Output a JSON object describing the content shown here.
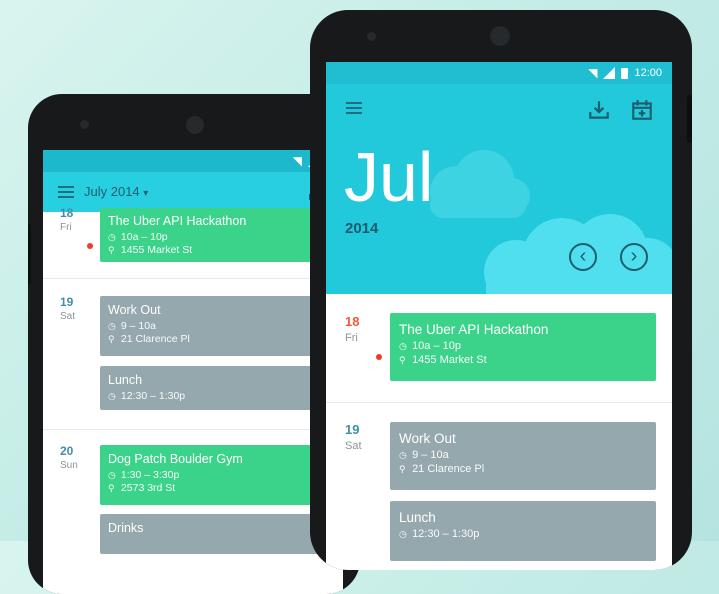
{
  "left_phone": {
    "header": {
      "month_label": "July 2014",
      "dropdown_caret": "▾"
    },
    "days": [
      {
        "num": "18",
        "wd": "Fri"
      },
      {
        "num": "19",
        "wd": "Sat"
      },
      {
        "num": "20",
        "wd": "Sun"
      }
    ],
    "events": [
      {
        "title": "The Uber API Hackathon",
        "time": "10a – 10p",
        "place": "1455 Market St",
        "color": "#3bd38a"
      },
      {
        "title": "Work Out",
        "time": "9 – 10a",
        "place": "21 Clarence Pl",
        "color": "#95a8ad"
      },
      {
        "title": "Lunch",
        "time": "12:30 – 1:30p",
        "color": "#95a8ad"
      },
      {
        "title": "Dog Patch Boulder Gym",
        "time": "1:30 – 3:30p",
        "place": "2573 3rd St",
        "color": "#3bd38a"
      },
      {
        "title": "Drinks",
        "color": "#95a8ad"
      }
    ]
  },
  "right_phone": {
    "status": {
      "time": "12:00"
    },
    "hero": {
      "month": "Jul",
      "year": "2014",
      "prev_glyph": "‹",
      "next_glyph": "›"
    },
    "days": [
      {
        "num": "18",
        "wd": "Fri"
      },
      {
        "num": "19",
        "wd": "Sat"
      }
    ],
    "events": [
      {
        "title": "The Uber API Hackathon",
        "time": "10a – 10p",
        "place": "1455 Market St",
        "color": "#3bd38a"
      },
      {
        "title": "Work Out",
        "time": "9 – 10a",
        "place": "21 Clarence Pl",
        "color": "#95a8ad"
      },
      {
        "title": "Lunch",
        "time": "12:30 – 1:30p",
        "color": "#95a8ad"
      }
    ]
  },
  "glyphs": {
    "clock": "◷",
    "pin": "⚲"
  },
  "colors": {
    "teal": "#20c4d7",
    "accent_red": "#ef3c2a",
    "event_green": "#3bd38a",
    "event_gray": "#95a8ad"
  }
}
